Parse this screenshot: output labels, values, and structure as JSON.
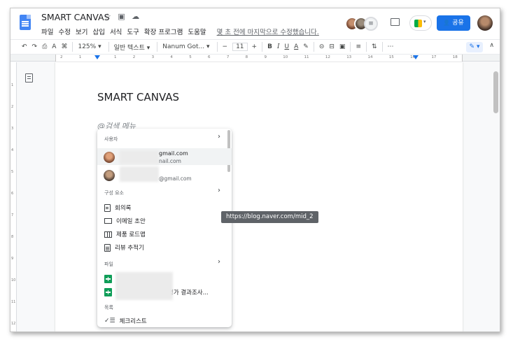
{
  "header": {
    "title": "SMART CANVAS",
    "title_icons": "☆ ▣ ☁",
    "menu": [
      "파일",
      "수정",
      "보기",
      "삽입",
      "서식",
      "도구",
      "확장 프로그램",
      "도움말"
    ],
    "last_edit": "몇 초 전에 마지막으로 수정했습니다.",
    "share_label": "공유",
    "share_icon": "👤"
  },
  "toolbar": {
    "undo": "↶",
    "redo": "↷",
    "print": "⎙",
    "spell": "A",
    "paint_format": "⌘",
    "zoom": "125%",
    "style": "일반 텍스트",
    "font": "Nanum Got...",
    "font_minus": "−",
    "font_size": "11",
    "font_plus": "+",
    "bold": "B",
    "italic": "I",
    "underline": "U",
    "text_color": "A",
    "highlight": "✎",
    "link": "⊝",
    "comment": "⊟",
    "image": "▣",
    "align": "≡",
    "line_spacing": "⇅",
    "more": "⋯",
    "edit_mode": "✎",
    "collapse": "∧"
  },
  "ruler": {
    "marks": [
      "2",
      "1",
      "",
      "1",
      "2",
      "3",
      "4",
      "5",
      "6",
      "7",
      "8",
      "9",
      "10",
      "11",
      "12",
      "13",
      "14",
      "15",
      "16",
      "17",
      "18"
    ]
  },
  "vruler": [
    "1",
    "2",
    "3",
    "4",
    "5",
    "6",
    "7",
    "8",
    "9",
    "10",
    "11",
    "12"
  ],
  "document": {
    "title": "SMART CANVAS",
    "at_query": "@검색 메뉴"
  },
  "menu": {
    "sections": {
      "people": "사용자",
      "components": "구성 요소",
      "files": "파일",
      "lists": "목록"
    },
    "people": [
      {
        "name": "gmail.com",
        "email": "nail.com"
      },
      {
        "email": "@gmail.com"
      }
    ],
    "components": [
      {
        "label": "회의록",
        "icon": "document-icon"
      },
      {
        "label": "이메일 초안",
        "icon": "mail-icon"
      },
      {
        "label": "제품 로드맵",
        "icon": "map-icon"
      },
      {
        "label": "리뷰 추적기",
        "icon": "clipboard-icon"
      }
    ],
    "files": [
      {
        "label": "",
        "icon": "sheets-icon"
      },
      {
        "label": "평가 결과조사...",
        "icon": "sheets-icon"
      }
    ],
    "lists": [
      {
        "label": "체크리스트",
        "icon": "checklist-icon"
      }
    ],
    "chevron": "›"
  },
  "tooltip": "https://blog.naver.com/mid_2",
  "colors": {
    "accent": "#1a73e8",
    "docs_blue": "#4285f4",
    "sheets_green": "#0f9d58"
  }
}
